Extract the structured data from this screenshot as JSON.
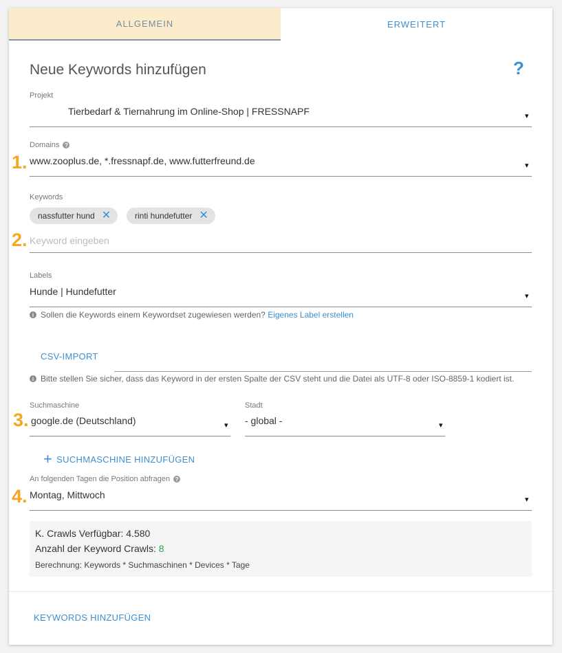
{
  "tabs": [
    {
      "label": "ALLGEMEIN",
      "active": true
    },
    {
      "label": "ERWEITERT",
      "active": false
    }
  ],
  "page_title": "Neue Keywords hinzufügen",
  "help_symbol": "?",
  "step_numbers": [
    "1.",
    "2.",
    "3.",
    "4."
  ],
  "projekt": {
    "label": "Projekt",
    "value": "Tierbedarf & Tiernahrung im Online-Shop | FRESSNAPF"
  },
  "domains": {
    "label": "Domains",
    "value": "www.zooplus.de, *.fressnapf.de, www.futterfreund.de"
  },
  "keywords": {
    "label": "Keywords",
    "chips": [
      "nassfutter hund",
      "rinti hundefutter"
    ],
    "placeholder": "Keyword eingeben"
  },
  "labels": {
    "label": "Labels",
    "value": "Hunde | Hundefutter",
    "info_text": "Sollen die Keywords einem Keywordset zugewiesen werden?",
    "info_link": "Eigenes Label erstellen"
  },
  "csv": {
    "button": "CSV-IMPORT",
    "info_text": "Bitte stellen Sie sicher, dass das Keyword in der ersten Spalte der CSV steht und die Datei als UTF-8 oder ISO-8859-1 kodiert ist."
  },
  "suchmaschine": {
    "label": "Suchmaschine",
    "value": "google.de (Deutschland)"
  },
  "stadt": {
    "label": "Stadt",
    "value": "- global -"
  },
  "add_engine_button": "SUCHMASCHINE HINZUFÜGEN",
  "tage": {
    "label": "An folgenden Tagen die Position abfragen",
    "value": "Montag, Mittwoch"
  },
  "summary": {
    "crawls_available": "K. Crawls Verfügbar: 4.580",
    "crawls_count_label": "Anzahl der Keyword Crawls:",
    "crawls_count_value": "8",
    "formula": "Berechnung: Keywords * Suchmaschinen * Devices * Tage"
  },
  "submit_button": "KEYWORDS HINZUFÜGEN",
  "colors": {
    "accent_blue": "#3d8fd1",
    "step_orange": "#f5a623",
    "active_tab_bg": "#fdeccb",
    "count_green": "#2e9e4a"
  },
  "icons": {
    "dropdown": "▾",
    "chip_remove": "✕",
    "info": "i",
    "add": "+"
  }
}
